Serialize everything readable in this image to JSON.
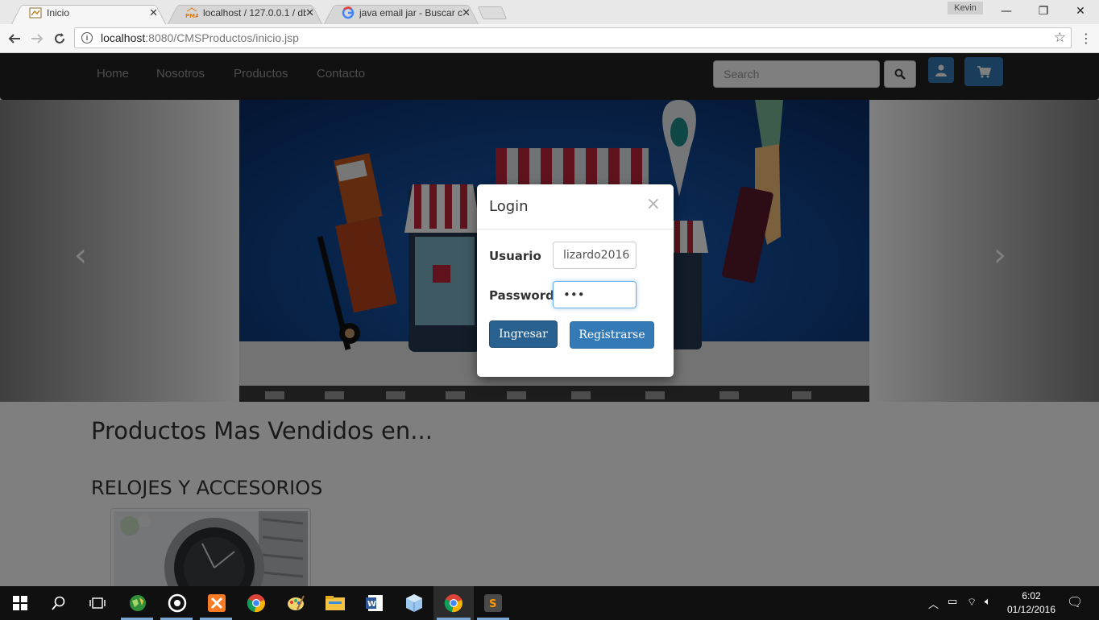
{
  "browser": {
    "tabs": [
      {
        "label": "Inicio",
        "favicon": "page-favicon-icon"
      },
      {
        "label": "localhost / 127.0.0.1 / db",
        "favicon": "phpmyadmin-favicon-icon"
      },
      {
        "label": "java email jar - Buscar co",
        "favicon": "google-favicon-icon"
      }
    ],
    "profile_name": "Kevin",
    "url_host": "localhost",
    "url_path": ":8080/CMSProductos/inicio.jsp"
  },
  "navbar": {
    "links": [
      "Home",
      "Nosotros",
      "Productos",
      "Contacto"
    ],
    "search_placeholder": "Search"
  },
  "content": {
    "section_title": "Productos Mas Vendidos en...",
    "category_title": "RELOJES Y ACCESORIOS"
  },
  "login_modal": {
    "title": "Login",
    "close_symbol": "×",
    "usuario_label": "Usuario",
    "usuario_value": "lizardo2016",
    "password_label": "Password",
    "password_value": "•••",
    "ingresar_label": "Ingresar",
    "registrarse_label": "Registrarse"
  },
  "taskbar": {
    "time": "6:02",
    "date": "01/12/2016"
  },
  "colors": {
    "navbar_bg": "#222222",
    "primary_button": "#337ab7",
    "primary_button_dark": "#286090",
    "slide_bg": "#0d3f86"
  }
}
